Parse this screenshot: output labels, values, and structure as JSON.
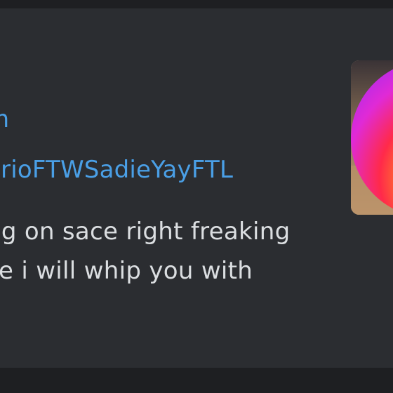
{
  "embed": {
    "author_line_1": "m",
    "author_line_2": "arioFTWSadieYayFTL",
    "description_line_1": "ng on sace right freaking",
    "description_line_2": "se i will whip you with"
  },
  "thumbnail": {
    "icon": "instagram-style-gradient-circle",
    "colors": [
      "#ff2a55",
      "#ff5f3c",
      "#ff9a1f",
      "#ffd21c",
      "#e02ad6"
    ]
  },
  "colors": {
    "background": "#1e1f22",
    "embed_background": "#2b2d31",
    "link_blue": "#4a9fe6",
    "text": "#dbdee1"
  }
}
